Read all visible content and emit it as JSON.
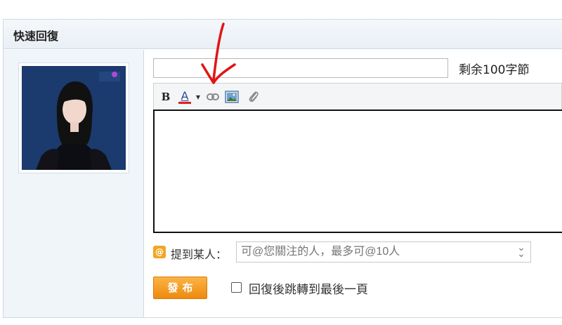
{
  "panel": {
    "title": "快速回復"
  },
  "form": {
    "subject_value": "",
    "remaining": "剩余100字節",
    "editor_value": ""
  },
  "toolbar": {
    "bold_label": "B",
    "color_label": "A",
    "icons": [
      "bold-icon",
      "font-color-icon",
      "dropdown-caret-icon",
      "link-icon",
      "image-icon",
      "attachment-icon"
    ]
  },
  "mention": {
    "icon_glyph": "@",
    "label": "提到某人：",
    "placeholder": "可@您關注的人，最多可@10人"
  },
  "submit": {
    "label": "發布"
  },
  "jump": {
    "label": "回復後跳轉到最後一頁",
    "checked": false
  },
  "colors": {
    "accent": "#ee8a0e",
    "annotation": "#e01515",
    "font_color_bar": "#e02020"
  }
}
